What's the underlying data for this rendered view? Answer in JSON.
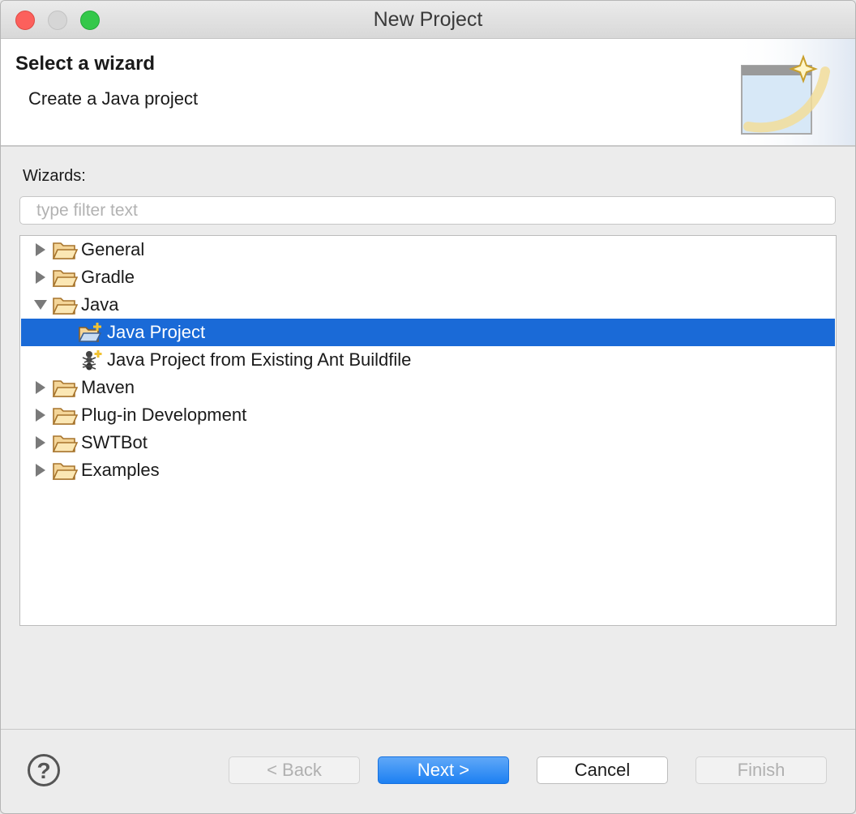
{
  "window": {
    "title": "New Project"
  },
  "header": {
    "title": "Select a wizard",
    "description": "Create a Java project"
  },
  "wizards": {
    "label": "Wizards:",
    "filter_placeholder": "type filter text",
    "filter_value": ""
  },
  "tree": {
    "items": [
      {
        "label": "General",
        "icon": "folder-icon",
        "expanded": false,
        "level": 0
      },
      {
        "label": "Gradle",
        "icon": "folder-icon",
        "expanded": false,
        "level": 0
      },
      {
        "label": "Java",
        "icon": "folder-icon",
        "expanded": true,
        "level": 0
      },
      {
        "label": "Java Project",
        "icon": "java-project-icon",
        "level": 1,
        "selected": true
      },
      {
        "label": "Java Project from Existing Ant Buildfile",
        "icon": "ant-icon",
        "level": 1
      },
      {
        "label": "Maven",
        "icon": "folder-icon",
        "expanded": false,
        "level": 0
      },
      {
        "label": "Plug-in Development",
        "icon": "folder-icon",
        "expanded": false,
        "level": 0
      },
      {
        "label": "SWTBot",
        "icon": "folder-icon",
        "expanded": false,
        "level": 0
      },
      {
        "label": "Examples",
        "icon": "folder-icon",
        "expanded": false,
        "level": 0
      }
    ]
  },
  "buttons": {
    "help": "?",
    "back": "< Back",
    "next": "Next >",
    "cancel": "Cancel",
    "finish": "Finish"
  },
  "colors": {
    "selection": "#1a6ad7",
    "default_button": "#1d80f2"
  }
}
